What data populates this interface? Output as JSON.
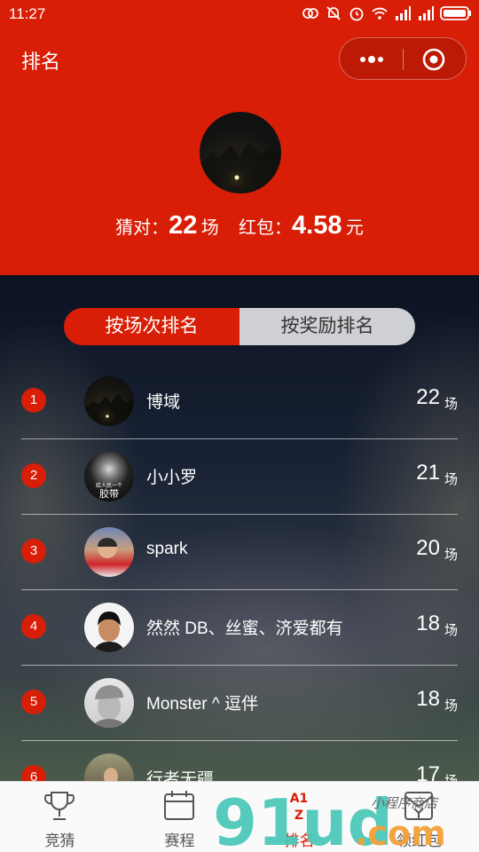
{
  "status_bar": {
    "time": "11:27"
  },
  "header": {
    "title": "排名",
    "summary": {
      "correct_label": "猜对：",
      "correct_value": "22",
      "correct_unit": "场",
      "redpacket_label": "红包：",
      "redpacket_value": "4.58",
      "redpacket_unit": "元"
    }
  },
  "tabs": [
    "按场次排名",
    "按奖励排名"
  ],
  "ranking": [
    {
      "rank": "1",
      "name": "博域",
      "score": "22",
      "unit": "场"
    },
    {
      "rank": "2",
      "name": "小小罗",
      "score": "21",
      "unit": "场"
    },
    {
      "rank": "3",
      "name": "spark",
      "score": "20",
      "unit": "场"
    },
    {
      "rank": "4",
      "name": "然然⁠ DB、丝蜜、济爱都有",
      "score": "18",
      "unit": "场"
    },
    {
      "rank": "5",
      "name": "Monster ^ 逗伴",
      "score": "18",
      "unit": "场"
    },
    {
      "rank": "6",
      "name": "行者无疆",
      "score": "17",
      "unit": "场"
    }
  ],
  "avatar2_text": [
    "给人民一个",
    "胶带"
  ],
  "tabbar": [
    {
      "label": "竞猜",
      "icon": "trophy-icon"
    },
    {
      "label": "赛程",
      "icon": "calendar-icon"
    },
    {
      "label": "排名",
      "icon": "ranking-icon"
    },
    {
      "label": "领红包",
      "icon": "redpacket-icon"
    }
  ],
  "watermark": {
    "brand": "91ud",
    "domain": ".com",
    "tagline": "小程序商店"
  },
  "colors": {
    "accent": "#d81e06",
    "tab_inactive": "#cfd0d4"
  }
}
